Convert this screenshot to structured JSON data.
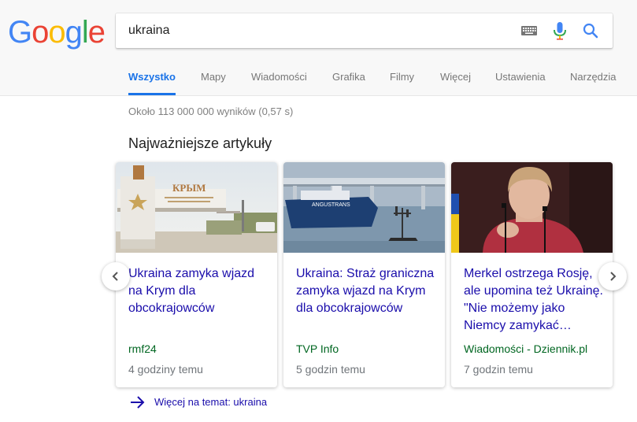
{
  "logo": {
    "letters": [
      "G",
      "o",
      "o",
      "g",
      "l",
      "e"
    ],
    "colors": [
      "#4285F4",
      "#EA4335",
      "#FBBC05",
      "#4285F4",
      "#34A853",
      "#EA4335"
    ]
  },
  "search": {
    "query": "ukraina"
  },
  "tabs": [
    {
      "label": "Wszystko",
      "active": true
    },
    {
      "label": "Mapy"
    },
    {
      "label": "Wiadomości"
    },
    {
      "label": "Grafika"
    },
    {
      "label": "Filmy"
    },
    {
      "label": "Więcej"
    },
    {
      "label": "Ustawienia"
    },
    {
      "label": "Narzędzia"
    }
  ],
  "results": {
    "stats": "Około 113 000 000 wyników (0,57 s)"
  },
  "top_stories": {
    "title": "Najważniejsze artykuły",
    "cards": [
      {
        "title": "Ukraina zamyka wjazd na Krym dla obcokrajowców",
        "source": "rmf24",
        "time": "4 godziny temu",
        "image": "crimea-border-sign-photo",
        "sign_text": "КРЫМ"
      },
      {
        "title": "Ukraina: Straż graniczna zamyka wjazd na Krym dla obcokrajowców",
        "source": "TVP Info",
        "time": "5 godzin temu",
        "image": "ship-under-bridge-photo",
        "ship_text": "ANGUSTRANS"
      },
      {
        "title": "Merkel ostrzega Rosję, ale upomina też Ukrainę. \"Nie możemy jako Niemcy zamykać…",
        "source": "Wiadomości - Dziennik.pl",
        "time": "7 godzin temu",
        "image": "angela-merkel-photo"
      }
    ],
    "more_link": "Więcej na temat: ukraina"
  },
  "colors": {
    "link": "#1a0dab",
    "source": "#006621",
    "accent": "#1a73e8"
  }
}
